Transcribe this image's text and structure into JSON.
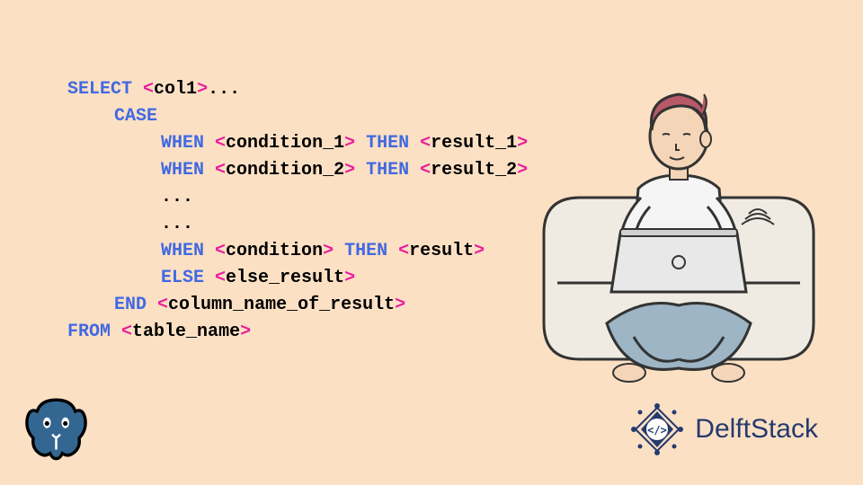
{
  "code": {
    "line1": {
      "select": "SELECT",
      "lt": "<",
      "col1": "col1",
      "gt": ">",
      "dots": "..."
    },
    "line2": {
      "case": "CASE"
    },
    "line3": {
      "when": "WHEN",
      "lt1": "<",
      "cond": "condition_1",
      "gt1": ">",
      "then": "THEN",
      "lt2": "<",
      "res": "result_1",
      "gt2": ">"
    },
    "line4": {
      "when": "WHEN",
      "lt1": "<",
      "cond": "condition_2",
      "gt1": ">",
      "then": "THEN",
      "lt2": "<",
      "res": "result_2",
      "gt2": ">"
    },
    "line5": {
      "dots": "..."
    },
    "line6": {
      "dots": "..."
    },
    "line7": {
      "when": "WHEN",
      "lt1": "<",
      "cond": "condition",
      "gt1": ">",
      "then": "THEN",
      "lt2": "<",
      "res": "result",
      "gt2": ">"
    },
    "line8": {
      "else": "ELSE",
      "lt": "<",
      "res": "else_result",
      "gt": ">"
    },
    "line9": {
      "end": "END",
      "lt": "<",
      "col": "column_name_of_result",
      "gt": ">"
    },
    "line10": {
      "from": "FROM",
      "lt": "<",
      "tbl": "table_name",
      "gt": ">"
    }
  },
  "brand": {
    "name": "DelftStack"
  }
}
